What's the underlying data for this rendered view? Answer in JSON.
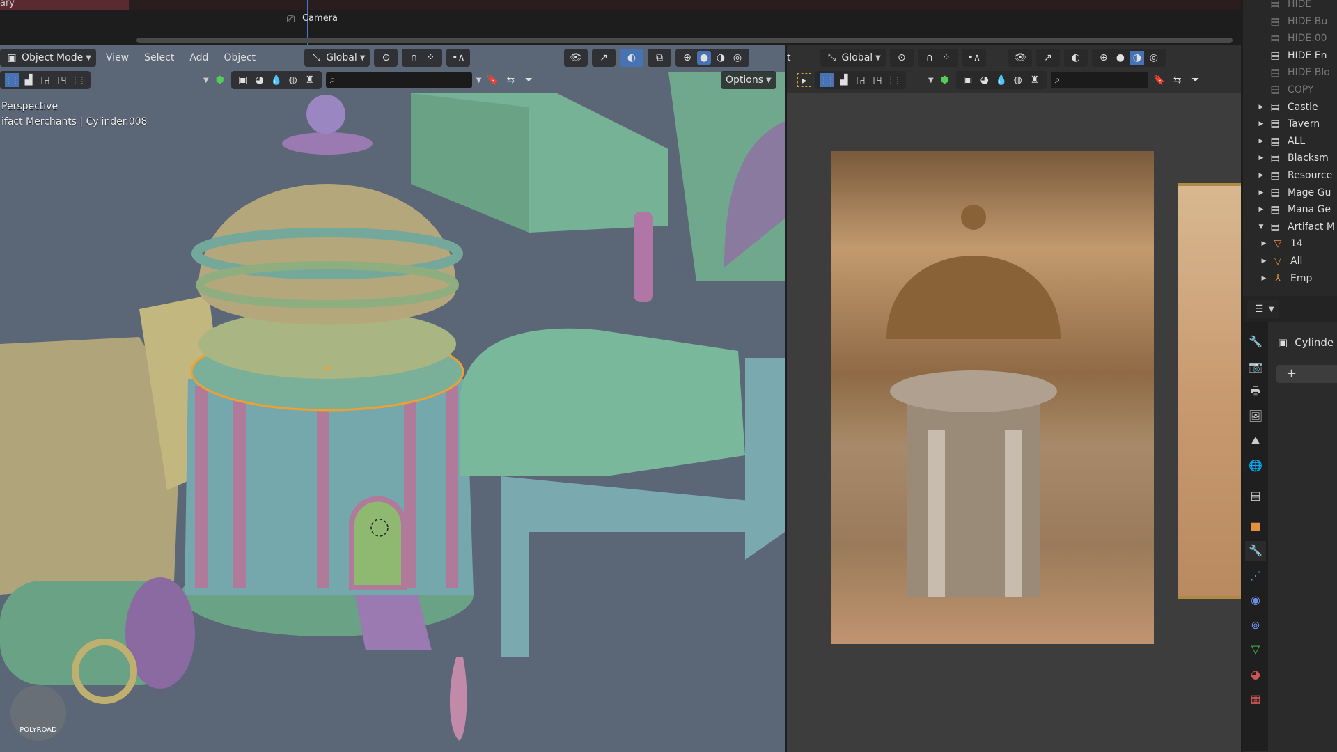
{
  "timeline": {
    "track_label": "ary",
    "camera_marker": "Camera"
  },
  "viewport": {
    "header": {
      "mode": "Object Mode",
      "menus": [
        "View",
        "Select",
        "Add",
        "Object"
      ],
      "transform_orientation": "Global",
      "options_label": "Options"
    },
    "info": {
      "view": "Perspective",
      "selection": "ifact Merchants | Cylinder.008"
    },
    "scene_colors": {
      "background": "#5b6677",
      "selection_outline": "#f0a030"
    }
  },
  "image_editor": {
    "header": {
      "cut_label": "t",
      "transform_orientation": "Global"
    }
  },
  "outliner": {
    "items": [
      {
        "label": "HIDE",
        "dim": true,
        "arrow": ""
      },
      {
        "label": "HIDE Bu",
        "dim": true,
        "arrow": ""
      },
      {
        "label": "HIDE.00",
        "dim": true,
        "arrow": ""
      },
      {
        "label": "HIDE En",
        "dim": false,
        "arrow": ""
      },
      {
        "label": "HIDE Blo",
        "dim": true,
        "arrow": ""
      },
      {
        "label": "COPY",
        "dim": true,
        "arrow": ""
      },
      {
        "label": "Castle",
        "dim": false,
        "arrow": "▶"
      },
      {
        "label": "Tavern",
        "dim": false,
        "arrow": "▶"
      },
      {
        "label": "ALL",
        "dim": false,
        "arrow": "▶"
      },
      {
        "label": "Blacksm",
        "dim": false,
        "arrow": "▶"
      },
      {
        "label": "Resource",
        "dim": false,
        "arrow": "▶"
      },
      {
        "label": "Mage Gu",
        "dim": false,
        "arrow": "▶"
      },
      {
        "label": "Mana Ge",
        "dim": false,
        "arrow": "▶"
      },
      {
        "label": "Artifact M",
        "dim": false,
        "arrow": "▼"
      },
      {
        "label": "14",
        "dim": false,
        "arrow": "▶",
        "child": true,
        "icon": "mesh"
      },
      {
        "label": "All",
        "dim": false,
        "arrow": "▶",
        "child": true,
        "icon": "mesh"
      },
      {
        "label": "Emp",
        "dim": false,
        "arrow": "▶",
        "child": true,
        "icon": "empty"
      }
    ]
  },
  "properties": {
    "object_name": "Cylinde",
    "add_modifier": "+",
    "tabs": [
      "tool",
      "render",
      "output",
      "view-layer",
      "scene",
      "world",
      "collection",
      "object",
      "modifiers",
      "particles",
      "physics",
      "constraints",
      "data",
      "material",
      "texture"
    ],
    "active_tab": "modifiers"
  },
  "watermark": "POLYROAD"
}
